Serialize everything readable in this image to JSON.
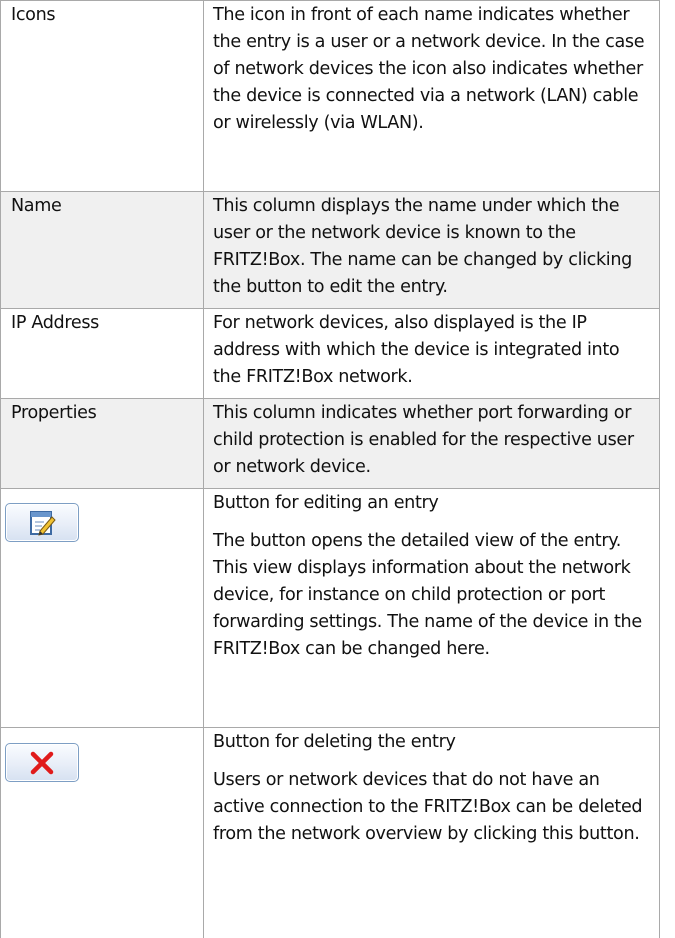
{
  "rows": [
    {
      "term": "Icons",
      "desc": "The icon in front of each name indicates whether the entry is a user or a network device. In the case of network devices the icon also indicates whether the device is connected via a network (LAN) cable or wirelessly (via WLAN)."
    },
    {
      "term": "Name",
      "desc": "This column displays the name under which the user or the network device is known to the FRITZ!Box. The name can be changed by clicking the button to edit the entry."
    },
    {
      "term": "IP Address",
      "desc": "For network devices, also displayed is the IP address with which the device is integrated into the FRITZ!Box network."
    },
    {
      "term": "Properties",
      "desc": "This column indicates whether port forwarding or child protection is enabled for the respective user or network device."
    },
    {
      "icon": "edit-icon",
      "title": "Button for editing an entry",
      "desc": "The button opens the detailed view of the entry. This view displays information about the network device, for instance on child protection or port forwarding settings. The name of the device in the FRITZ!Box can be changed here."
    },
    {
      "icon": "delete-icon",
      "title": "Button for deleting the entry",
      "desc": "Users or network devices that do not have an active connection to the FRITZ!Box can be deleted from the network overview by clicking this button."
    }
  ],
  "colors": {
    "shaded_row": "#f0f0f0",
    "border": "#a9a9a9",
    "delete_red": "#e01b1b",
    "button_border": "#7d9ec4"
  }
}
